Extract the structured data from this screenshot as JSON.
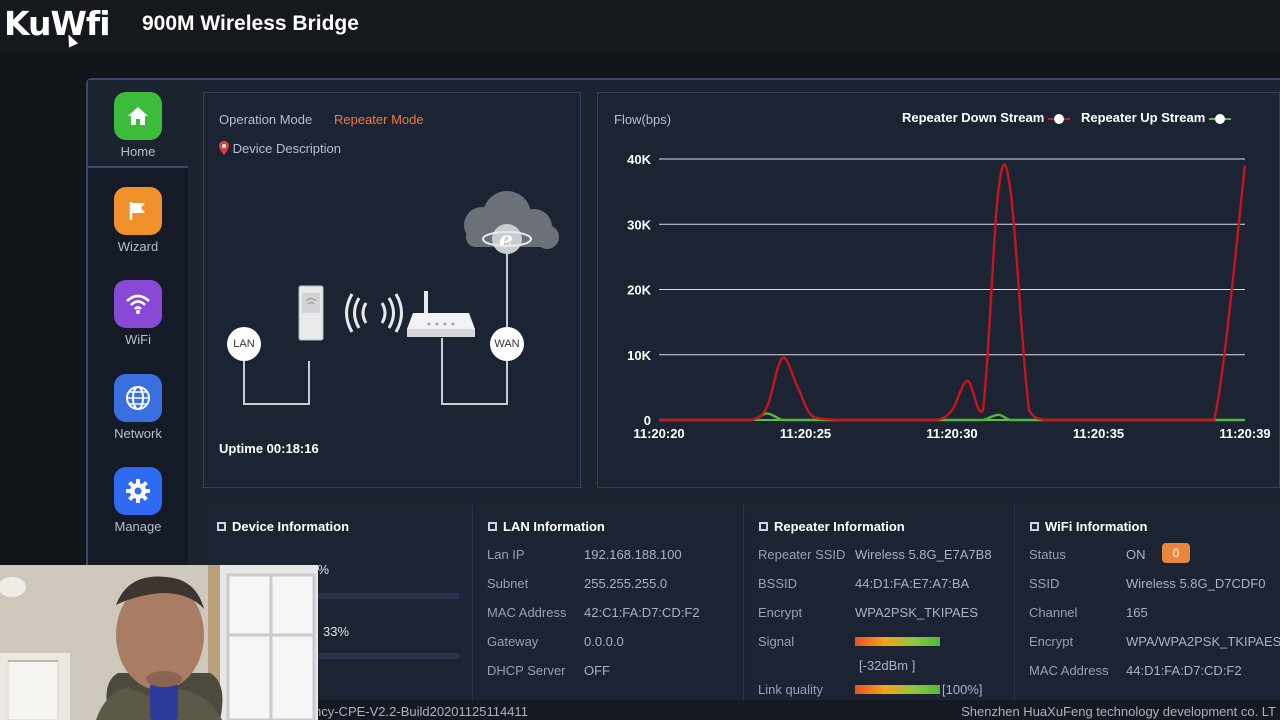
{
  "brand": {
    "logo": "KuWfi",
    "title": "900M Wireless Bridge"
  },
  "sidebar": {
    "items": [
      {
        "label": "Home",
        "icon": "home-icon",
        "color": "#3dbb3a"
      },
      {
        "label": "Wizard",
        "icon": "flag-icon",
        "color": "#f0902a"
      },
      {
        "label": "WiFi",
        "icon": "wifi-icon",
        "color": "#8a48d6"
      },
      {
        "label": "Network",
        "icon": "globe-icon",
        "color": "#3a6fe0"
      },
      {
        "label": "Manage",
        "icon": "gear-icon",
        "color": "#2f6bf0"
      }
    ]
  },
  "device": {
    "operation_mode_label": "Operation Mode",
    "operation_mode_value": "Repeater Mode",
    "description_label": "Device Description",
    "lan_label": "LAN",
    "wan_label": "WAN",
    "uptime": "Uptime 00:18:16"
  },
  "chart_data": {
    "type": "line",
    "ylabel": "Flow(bps)",
    "ylim": [
      0,
      40000
    ],
    "y_ticks": [
      "0",
      "10K",
      "20K",
      "30K",
      "40K"
    ],
    "x_ticks": [
      "11:20:20",
      "11:20:25",
      "11:20:30",
      "11:20:35",
      "11:20:39"
    ],
    "x": [
      0,
      1,
      2,
      3,
      3.5,
      4,
      4.5,
      5,
      6,
      7,
      8,
      9,
      9.5,
      10,
      10.5,
      11,
      11.4,
      12,
      12.5,
      13,
      14,
      15,
      16,
      17,
      18,
      19
    ],
    "series": [
      {
        "name": "Repeater Down Stream",
        "color": "#c8141c",
        "values": [
          0,
          0,
          0,
          0,
          2000,
          9500,
          5000,
          500,
          0,
          0,
          0,
          0,
          1500,
          6000,
          1500,
          35000,
          35000,
          1500,
          0,
          0,
          0,
          0,
          0,
          0,
          0,
          39000
        ]
      },
      {
        "name": "Repeater Up Stream",
        "color": "#4fb83b",
        "values": [
          0,
          0,
          0,
          0,
          1000,
          0,
          0,
          0,
          0,
          0,
          0,
          0,
          0,
          0,
          0,
          800,
          0,
          0,
          0,
          0,
          0,
          0,
          0,
          0,
          0,
          0
        ]
      }
    ],
    "grid": true,
    "legend": "top-right"
  },
  "device_info": {
    "title": "Device Information",
    "cpu": "10%",
    "memory": "33%"
  },
  "lan_info": {
    "title": "LAN Information",
    "rows": [
      {
        "k": "Lan IP",
        "v": "192.168.188.100"
      },
      {
        "k": "Subnet",
        "v": "255.255.255.0"
      },
      {
        "k": "MAC Address",
        "v": "42:C1:FA:D7:CD:F2"
      },
      {
        "k": "Gateway",
        "v": "0.0.0.0"
      },
      {
        "k": "DHCP Server",
        "v": "OFF"
      }
    ]
  },
  "repeater_info": {
    "title": "Repeater Information",
    "ssid_label": "Repeater SSID",
    "ssid": "Wireless 5.8G_E7A7B8",
    "bssid_label": "BSSID",
    "bssid": "44:D1:FA:E7:A7:BA",
    "encrypt_label": "Encrypt",
    "encrypt": "WPA2PSK_TKIPAES",
    "signal_label": "Signal",
    "signal_dbm": "[-32dBm ]",
    "link_label": "Link quality",
    "link_value": "[100%]"
  },
  "wifi_info": {
    "title": "WiFi Information",
    "status_label": "Status",
    "status": "ON",
    "status_badge": "0",
    "ssid_label": "SSID",
    "ssid": "Wireless 5.8G_D7CDF0",
    "channel_label": "Channel",
    "channel": "165",
    "encrypt_label": "Encrypt",
    "encrypt": "WPA/WPA2PSK_TKIPAES",
    "mac_label": "MAC Address",
    "mac": "44:D1:FA:D7:CD:F2"
  },
  "footer": {
    "firmware": "ncy-CPE-V2.2-Build20201125114411",
    "company": "Shenzhen HuaXuFeng technology development co. LT"
  }
}
